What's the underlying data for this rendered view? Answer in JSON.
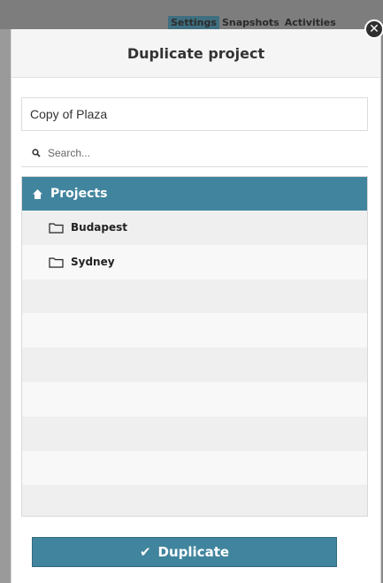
{
  "background": {
    "tabs": [
      "Settings",
      "Snapshots",
      "Activities"
    ],
    "active_tab": "Settings"
  },
  "dialog": {
    "title": "Duplicate project",
    "close_icon": "close-circle-icon",
    "name_value": "Copy of Plaza",
    "search_placeholder": "Search...",
    "search_icon": "search-icon",
    "tree": {
      "root": {
        "label": "Projects",
        "icon": "home-icon"
      },
      "items": [
        {
          "label": "Budapest",
          "icon": "folder-icon"
        },
        {
          "label": "Sydney",
          "icon": "folder-icon"
        }
      ],
      "empty_rows": 7
    },
    "action_button": {
      "label": "Duplicate",
      "icon": "checkmark-icon"
    }
  },
  "colors": {
    "accent": "#41849d",
    "header_bg": "#f5f5f5",
    "overlay": "#8a8a8a"
  }
}
